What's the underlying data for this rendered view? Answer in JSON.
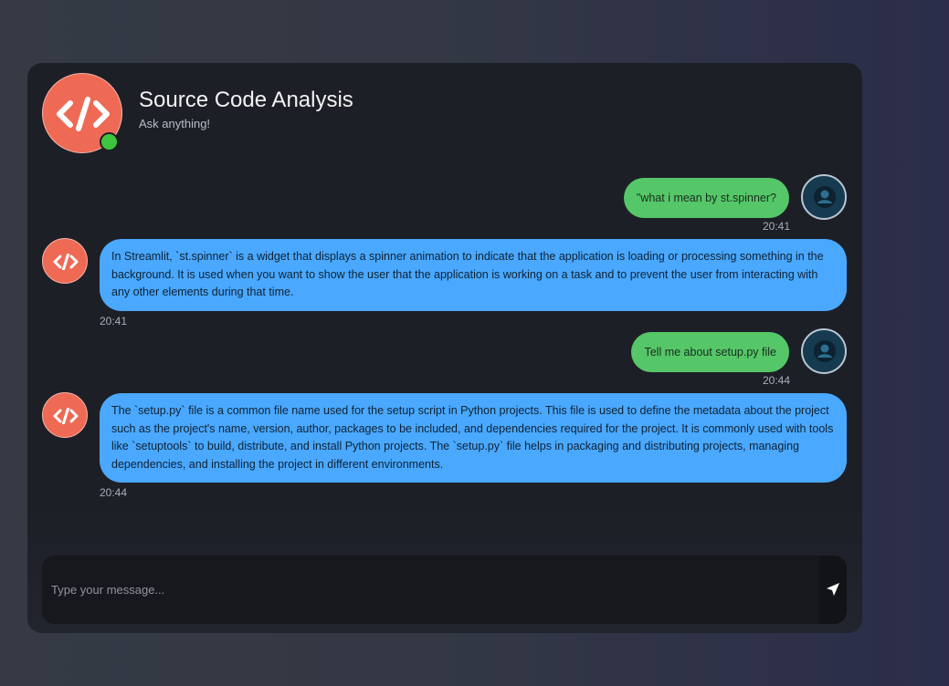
{
  "header": {
    "title": "Source Code Analysis",
    "subtitle": "Ask anything!"
  },
  "messages": [
    {
      "role": "user",
      "text": "\"what i mean by st.spinner?",
      "time": "20:41"
    },
    {
      "role": "bot",
      "text": "In Streamlit, `st.spinner` is a widget that displays a spinner animation to indicate that the application is loading or processing something in the background. It is used when you want to show the user that the application is working on a task and to prevent the user from interacting with any other elements during that time.",
      "time": "20:41"
    },
    {
      "role": "user",
      "text": "Tell me about setup.py file",
      "time": "20:44"
    },
    {
      "role": "bot",
      "text": "The `setup.py` file is a common file name used for the setup script in Python projects. This file is used to define the metadata about the project such as the project's name, version, author, packages to be included, and dependencies required for the project. It is commonly used with tools like `setuptools` to build, distribute, and install Python projects. The `setup.py` file helps in packaging and distributing projects, managing dependencies, and installing the project in different environments.",
      "time": "20:44"
    }
  ],
  "input": {
    "placeholder": "Type your message..."
  },
  "icons": {
    "header_avatar": "code-icon",
    "online": "online-status-dot",
    "user_avatar": "user-icon",
    "bot_avatar": "code-icon",
    "send": "send-icon"
  },
  "colors": {
    "user_bubble": "#55c768",
    "bot_bubble": "#4aa8ff",
    "bot_avatar": "#ee6a55",
    "online": "#3ec53e"
  }
}
